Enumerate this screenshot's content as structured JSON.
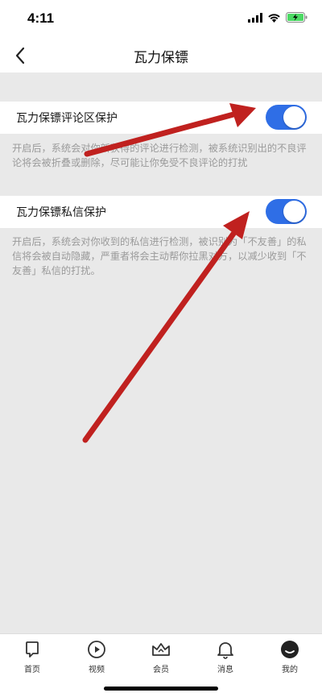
{
  "status_bar": {
    "time": "4:11"
  },
  "nav": {
    "title": "瓦力保镖"
  },
  "settings": [
    {
      "label": "瓦力保镖评论区保护",
      "enabled": true,
      "description": "开启后，系统会对你新获得的评论进行检测，被系统识别出的不良评论将会被折叠或删除，尽可能让你免受不良评论的打扰"
    },
    {
      "label": "瓦力保镖私信保护",
      "enabled": true,
      "description": "开启后，系统会对你收到的私信进行检测，被识别为「不友善」的私信将会被自动隐藏，严重者将会主动帮你拉黑对方，以减少收到「不友善」私信的打扰。"
    }
  ],
  "tabs": [
    {
      "label": "首页",
      "icon": "home-icon"
    },
    {
      "label": "视频",
      "icon": "video-icon"
    },
    {
      "label": "会员",
      "icon": "crown-icon"
    },
    {
      "label": "消息",
      "icon": "bell-icon"
    },
    {
      "label": "我的",
      "icon": "profile-icon"
    }
  ],
  "colors": {
    "toggle_on": "#2f6ee6",
    "arrow": "#c0211f",
    "background": "#e9e9e9"
  }
}
